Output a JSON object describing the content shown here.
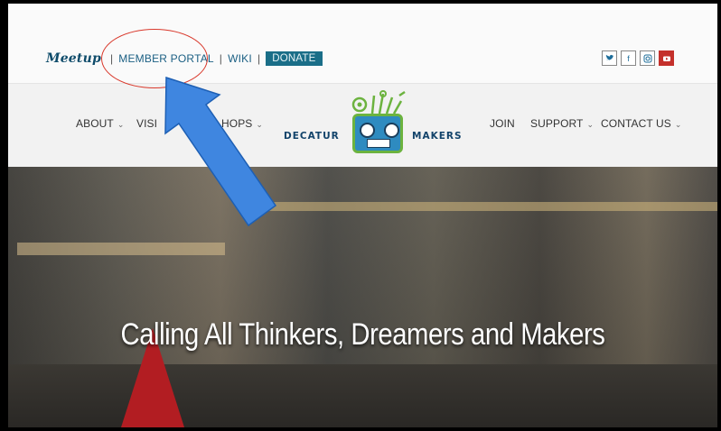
{
  "topbar": {
    "meetup_label": "Meetup",
    "sep1": "|",
    "member_portal": "MEMBER PORTAL",
    "sep2": "|",
    "wiki": "WIKI",
    "sep3": "|",
    "donate": "DONATE",
    "social": [
      {
        "name": "twitter-icon",
        "glyph": "🐦"
      },
      {
        "name": "facebook-icon",
        "glyph": "f"
      },
      {
        "name": "instagram-icon",
        "glyph": "◎"
      },
      {
        "name": "youtube-icon",
        "glyph": "▶"
      }
    ]
  },
  "nav": {
    "about": "ABOUT",
    "visit": "VISI",
    "workshops": "HOPS",
    "join": "JOIN",
    "support": "SUPPORT",
    "contact": "CONTACT US"
  },
  "logo": {
    "left": "DECATUR",
    "right": "MAKERS"
  },
  "hero": {
    "title": "Calling All Thinkers, Dreamers and Makers"
  },
  "colors": {
    "accent": "#1a6e88",
    "annotation_arrow": "#3f86e0",
    "annotation_circle": "#d9392c",
    "logo_green": "#6cb33f",
    "logo_blue": "#2e8bc0"
  }
}
